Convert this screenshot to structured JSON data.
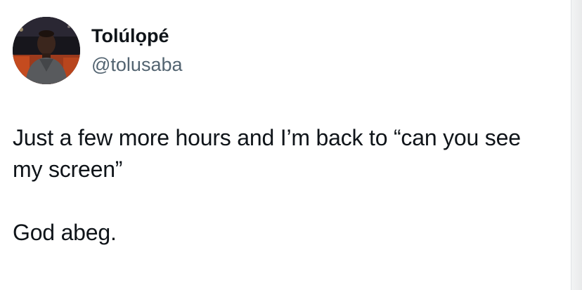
{
  "author": {
    "display_name": "Tolúlọpé",
    "handle": "@tolusaba",
    "avatar_icon": "profile-photo"
  },
  "tweet": {
    "paragraphs": [
      "Just a few more hours and I’m back to “can you see my screen”",
      "God abeg."
    ]
  },
  "colors": {
    "text": "#0f1419",
    "handle": "#536471",
    "background": "#ffffff"
  }
}
